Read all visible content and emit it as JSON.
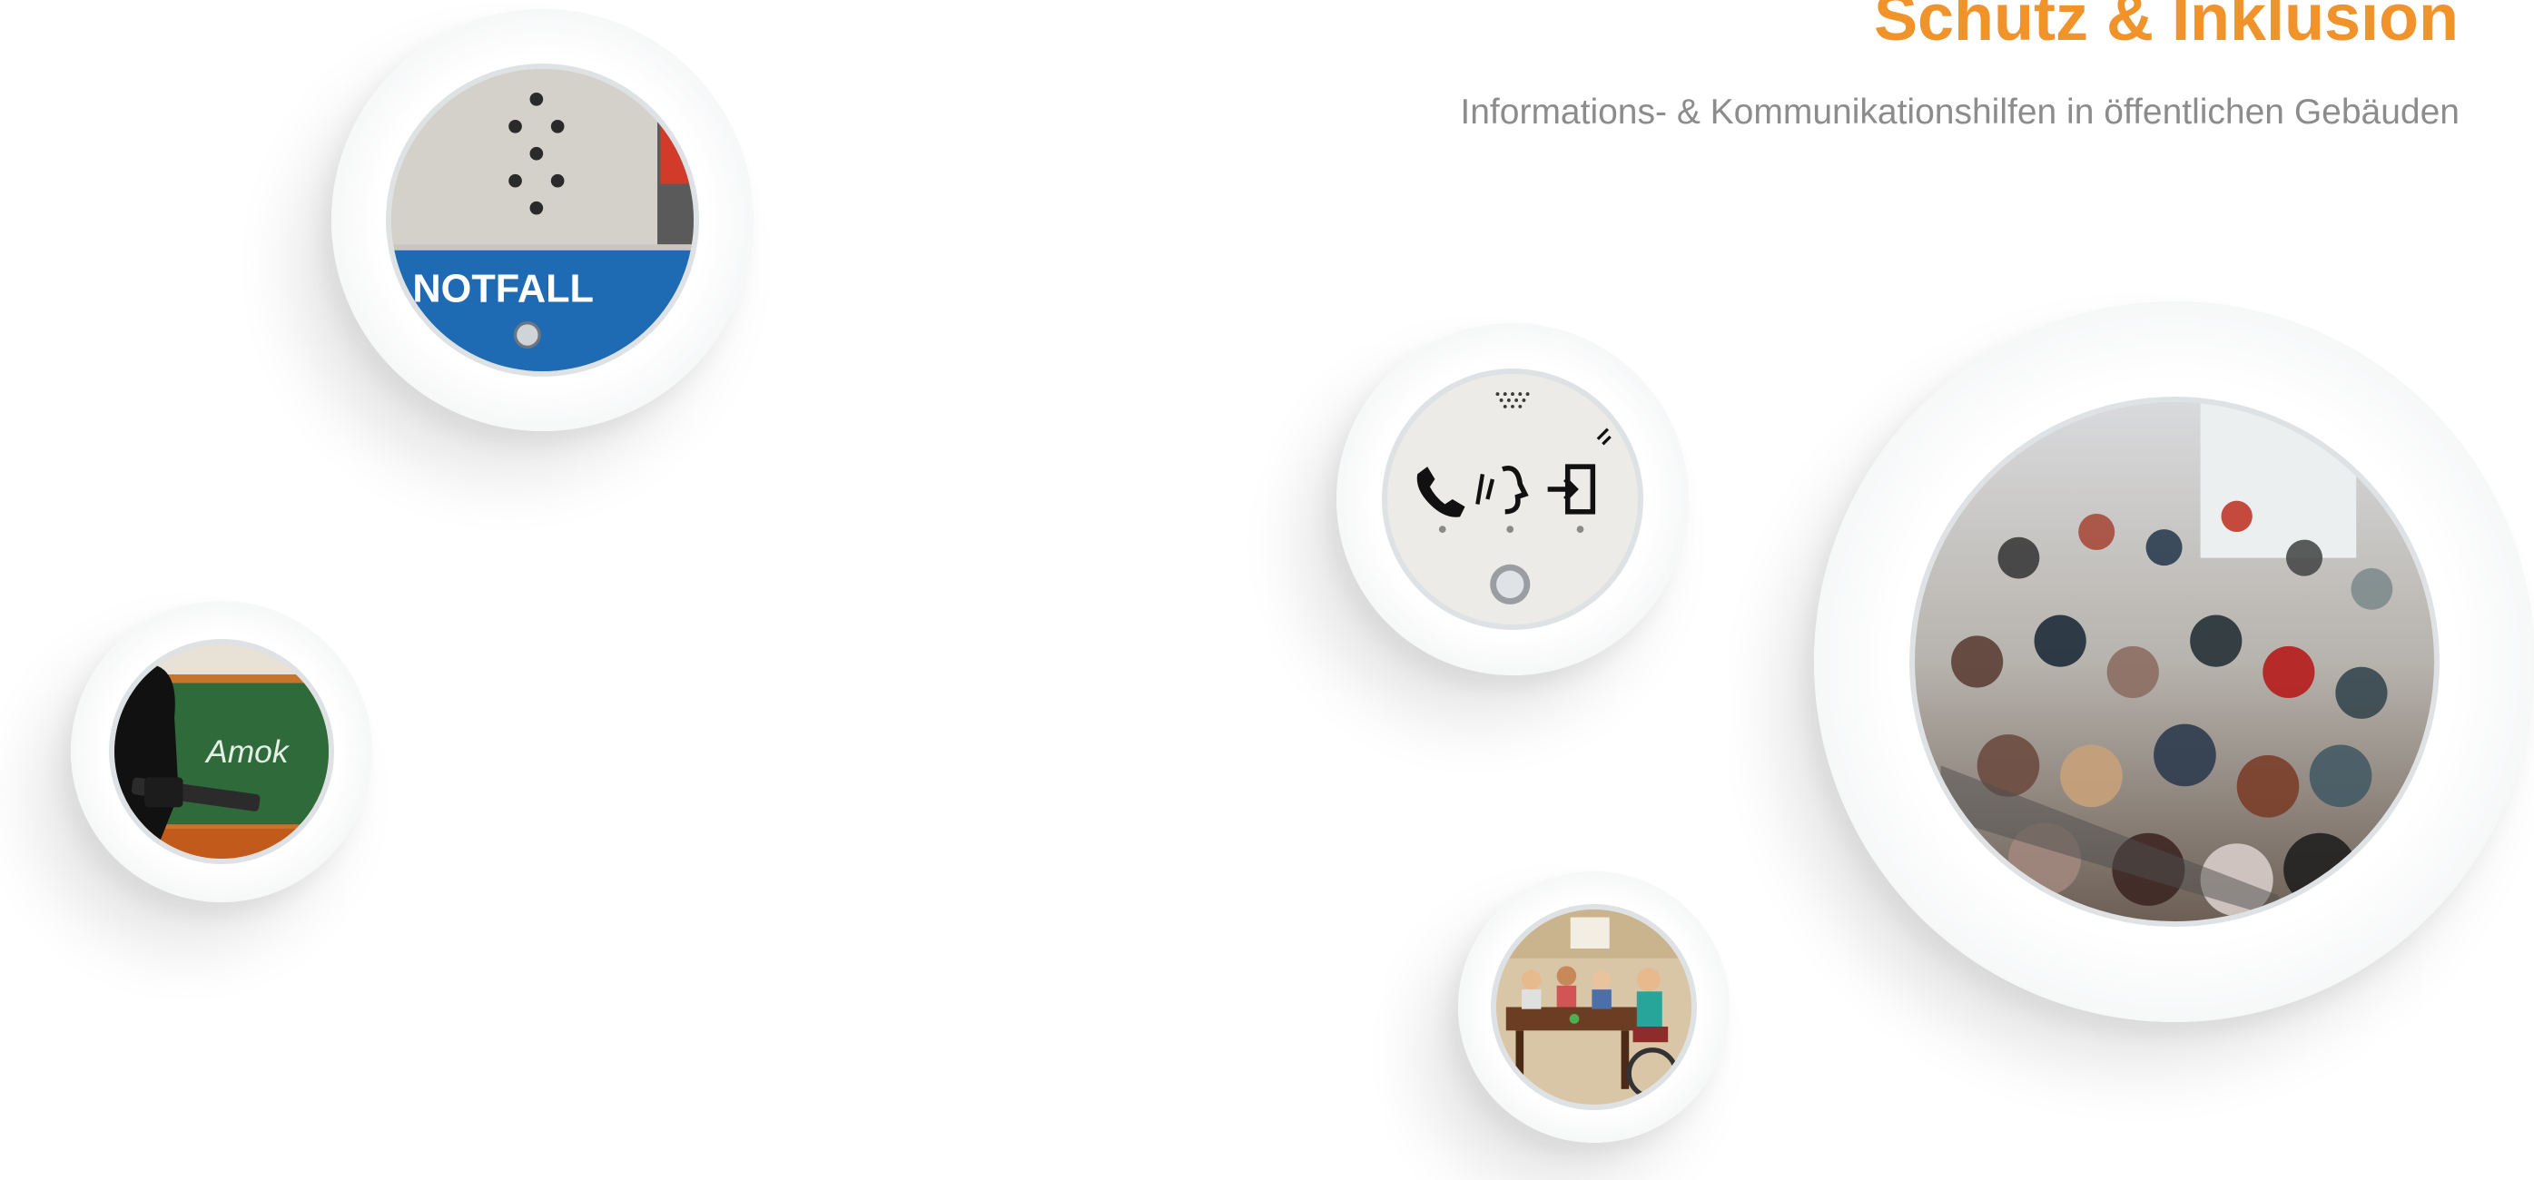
{
  "header": {
    "title": "Schutz & Inklusion",
    "subtitle": "Informations- & Kommunikationshilfen in öffentlichen Gebäuden"
  },
  "images": {
    "notfall": {
      "label": "NOTFALL"
    },
    "amok": {
      "label": "Amok"
    }
  },
  "colors": {
    "accent": "#f0932b",
    "subtitle": "#8c8c8c",
    "notfall_panel": "#1f6bb3",
    "chalkboard": "#2f6b3a"
  }
}
